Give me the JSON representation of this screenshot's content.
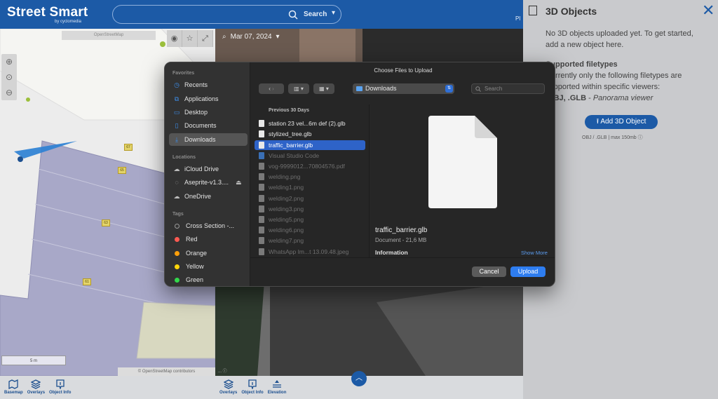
{
  "app": {
    "brand_title": "Street Smart",
    "brand_subtitle": "by cyclomedia",
    "search_label": "Search",
    "topbar_fragment": "Pl"
  },
  "map": {
    "attribution_top": "OpenStreetMap",
    "attribution_bottom": "© OpenStreetMap contributors",
    "scale_label": "5 m",
    "lot_numbers": [
      "67",
      "65",
      "63",
      "61"
    ],
    "toolbar": [
      {
        "name": "basemap",
        "label": "Basemap"
      },
      {
        "name": "overlays",
        "label": "Overlays"
      },
      {
        "name": "object-info",
        "label": "Object Info"
      }
    ]
  },
  "pano": {
    "date": "Mar 07, 2024",
    "attribution": "... ⓘ",
    "toolbar": [
      {
        "name": "overlays",
        "label": "Overlays"
      },
      {
        "name": "object-info",
        "label": "Object Info"
      },
      {
        "name": "elevation",
        "label": "Elevation"
      }
    ]
  },
  "side_panel": {
    "title": "3D Objects",
    "empty_text": "No 3D objects uploaded yet. To get started, add a new object here.",
    "supported_heading": "Supported filetypes",
    "supported_text": "Currently only the following filetypes are supported within specific viewers:",
    "filetypes_bold": ".OBJ, .GLB",
    "filetypes_viewer": "Panorama viewer",
    "add_button": "Add 3D Object",
    "add_note": "OBJ / .GLB | max 150mb"
  },
  "dialog": {
    "title": "Choose Files to Upload",
    "location": "Downloads",
    "search_placeholder": "Search",
    "sections": {
      "favorites": "Favorites",
      "locations": "Locations",
      "tags": "Tags"
    },
    "favorites": [
      {
        "label": "Recents",
        "icon": "clock-icon"
      },
      {
        "label": "Applications",
        "icon": "applications-icon"
      },
      {
        "label": "Desktop",
        "icon": "desktop-icon"
      },
      {
        "label": "Documents",
        "icon": "document-icon"
      },
      {
        "label": "Downloads",
        "icon": "download-icon"
      }
    ],
    "locations": [
      {
        "label": "iCloud Drive",
        "icon": "cloud-icon"
      },
      {
        "label": "Aseprite-v1.3....",
        "icon": "disk-icon"
      },
      {
        "label": "OneDrive",
        "icon": "cloud-icon"
      }
    ],
    "tags": [
      {
        "label": "Cross Section -...",
        "color": "#9a9a9a"
      },
      {
        "label": "Red",
        "color": "#ff5a52"
      },
      {
        "label": "Orange",
        "color": "#ff9f0a"
      },
      {
        "label": "Yellow",
        "color": "#ffd60a"
      },
      {
        "label": "Green",
        "color": "#32d74b"
      }
    ],
    "column_header": "Previous 30 Days",
    "files": [
      {
        "name": "station 23 vel...6m def (2).glb",
        "enabled": true
      },
      {
        "name": "stylized_tree.glb",
        "enabled": true
      },
      {
        "name": "traffic_barrier.glb",
        "enabled": true,
        "selected": true
      },
      {
        "name": "Visual Studio Code",
        "enabled": false
      },
      {
        "name": "vog-9999012...70804576.pdf",
        "enabled": false
      },
      {
        "name": "welding.png",
        "enabled": false
      },
      {
        "name": "welding1.png",
        "enabled": false
      },
      {
        "name": "welding2.png",
        "enabled": false
      },
      {
        "name": "welding3.png",
        "enabled": false
      },
      {
        "name": "welding5.png",
        "enabled": false
      },
      {
        "name": "welding6.png",
        "enabled": false
      },
      {
        "name": "welding7.png",
        "enabled": false
      },
      {
        "name": "WhatsApp Im...t 13.09.48.jpeg",
        "enabled": false
      }
    ],
    "preview": {
      "name": "traffic_barrier.glb",
      "meta": "Document - 21,6 MB",
      "info_label": "Information",
      "show_more": "Show More"
    },
    "cancel_label": "Cancel",
    "upload_label": "Upload"
  }
}
